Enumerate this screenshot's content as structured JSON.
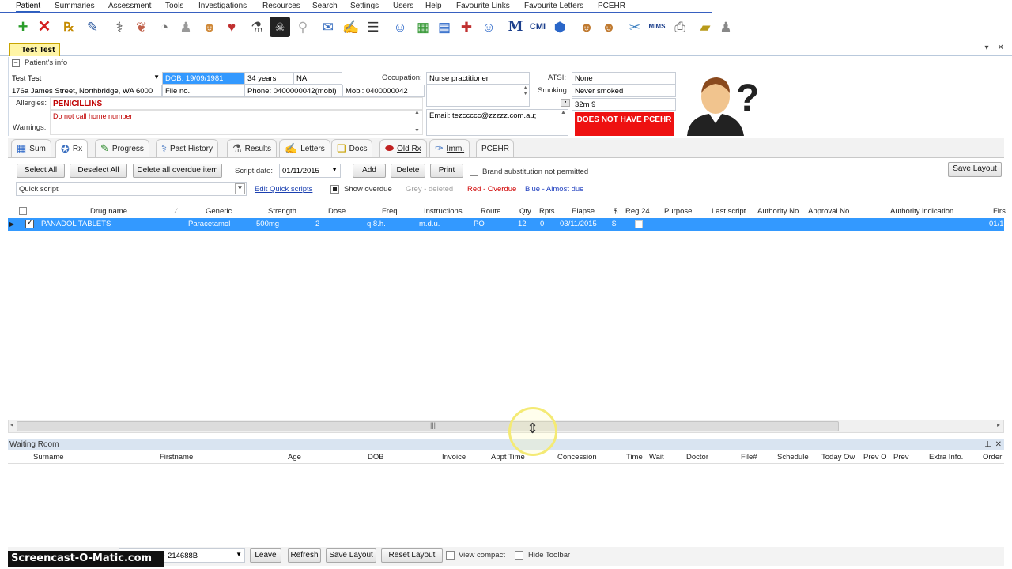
{
  "menu": {
    "items": [
      "Patient",
      "Summaries",
      "Assessment",
      "Tools",
      "Investigations",
      "Resources",
      "Search",
      "Settings",
      "Users",
      "Help",
      "Favourite Links",
      "Favourite Letters",
      "PCEHR"
    ]
  },
  "toolbar": {
    "icons": [
      "add-icon",
      "close-icon",
      "rx-icon",
      "edit-icon",
      "stethoscope-icon",
      "lungs-icon",
      "weight-scale-icon",
      "person-icon",
      "brain-icon",
      "heart-icon",
      "microscope-icon",
      "xray-icon",
      "pelvis-icon",
      "mail-icon",
      "write-icon",
      "speech-icon",
      "user-icon",
      "calculator-icon",
      "calendar-icon",
      "referral-icon",
      "mims-m-icon",
      "cmi-icon",
      "link-icon",
      "person-clock-icon",
      "person-star-icon",
      "scissors-icon",
      "vims-icon",
      "printer-icon",
      "book-icon",
      "person-grey-icon"
    ]
  },
  "patient_tab": {
    "label": "Test Test"
  },
  "patient_info": {
    "section_label": "Patient's info",
    "name": "Test Test",
    "dob": "DOB: 19/09/1981",
    "age": "34 years",
    "na": "NA",
    "occupation_label": "Occupation:",
    "occupation": "Nurse practitioner",
    "atsi_label": "ATSI:",
    "atsi": "None",
    "address": "176a James Street, Northbridge, WA 6000",
    "file_no": "File no.:",
    "phone": "Phone: 0400000042(mobi)",
    "mobi": "Mobi: 0400000042",
    "smoking_label": "Smoking:",
    "smoking": "Never smoked",
    "bmi": "32m 9",
    "allergies_label": "Allergies:",
    "allergies": "PENICILLINS",
    "warnings_label": "Warnings:",
    "warnings": "Do not call home number",
    "email": "Email: tezccccc@zzzzz.com.au;",
    "pcehr_badge": "DOES NOT HAVE PCEHR"
  },
  "tabs": [
    {
      "label": "Sum",
      "icon": "summary-icon"
    },
    {
      "label": "Rx",
      "icon": "rx-pill-icon"
    },
    {
      "label": "Progress",
      "icon": "progress-icon"
    },
    {
      "label": "Past History",
      "icon": "stethoscope-icon"
    },
    {
      "label": "Results",
      "icon": "microscope-icon"
    },
    {
      "label": "Letters",
      "icon": "pen-icon"
    },
    {
      "label": "Docs",
      "icon": "docs-icon"
    },
    {
      "label": "Old Rx",
      "icon": "capsule-icon"
    },
    {
      "label": "Imm.",
      "icon": "syringe-icon"
    },
    {
      "label": "PCEHR",
      "icon": ""
    }
  ],
  "rx_toolbar": {
    "select_all": "Select All",
    "deselect_all": "Deselect All",
    "delete_overdue": "Delete all overdue item",
    "script_date_label": "Script date:",
    "script_date": "01/11/2015",
    "add": "Add",
    "delete": "Delete",
    "print": "Print",
    "brand_sub": "Brand substitution not permitted",
    "save_layout": "Save Layout",
    "quick_script_placeholder": "Quick script",
    "edit_quick_scripts": "Edit Quick scripts",
    "show_overdue": "Show overdue",
    "legend_grey": "Grey - deleted",
    "legend_red": "Red - Overdue",
    "legend_blue": "Blue - Almost due",
    "color_grey": "#a0a0a0",
    "color_red": "#d00000",
    "color_blue": "#1f3fbf"
  },
  "grid": {
    "headers": [
      "Drug name",
      "Generic",
      "Strength",
      "Dose",
      "Freq",
      "Instructions",
      "Route",
      "Qty",
      "Rpts",
      "Elapse",
      "$",
      "Reg.24",
      "Purpose",
      "Last script",
      "Authority No.",
      "Approval No.",
      "Authority indication",
      "Firs"
    ],
    "rows": [
      {
        "drug": "PANADOL TABLETS",
        "generic": "Paracetamol",
        "strength": "500mg",
        "dose": "2",
        "freq": "q.8.h.",
        "instructions": "m.d.u.",
        "route": "PO",
        "qty": "12",
        "rpts": "0",
        "elapse": "03/11/2015",
        "price": "$",
        "first": "01/1"
      }
    ]
  },
  "waiting_room": {
    "title": "Waiting Room",
    "headers": [
      "Surname",
      "Firstname",
      "Age",
      "DOB",
      "Invoice",
      "Appt Time",
      "Concession",
      "Time",
      "Wait",
      "Doctor",
      "File#",
      "Schedule",
      "Today Ow",
      "Prev O",
      "Prev",
      "Extra Info.",
      "Order"
    ]
  },
  "bottom_bar": {
    "doctor_select": "DR VEVOD - 214688B",
    "leave": "Leave",
    "refresh": "Refresh",
    "save_layout": "Save Layout",
    "reset_layout": "Reset Layout",
    "view_compact": "View compact",
    "hide_toolbar": "Hide Toolbar"
  },
  "watermark": "Screencast-O-Matic.com"
}
